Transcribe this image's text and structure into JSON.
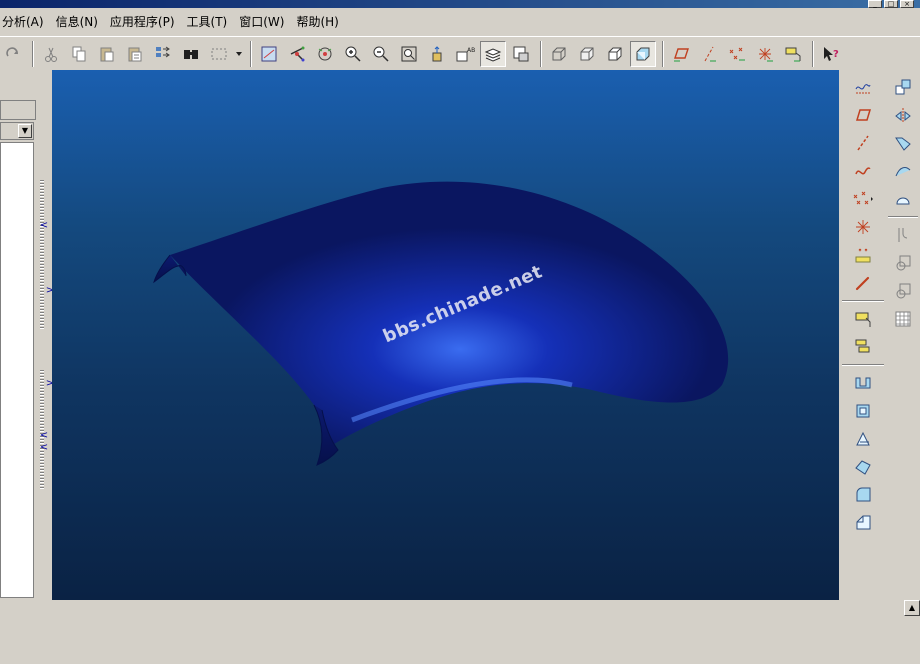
{
  "menubar": {
    "items": [
      "分析(A)",
      "信息(N)",
      "应用程序(P)",
      "工具(T)",
      "窗口(W)",
      "帮助(H)"
    ]
  },
  "window_controls": [
    "_",
    "□",
    "×"
  ],
  "viewport": {
    "watermark": "bbs.chinade.net",
    "background_top": "#1a5fb0",
    "background_bottom": "#0a2244",
    "surface_color": "#0d1f7a"
  },
  "toolbar": {
    "icons": [
      "redo-icon",
      "cut-icon",
      "copy-icon",
      "paste-icon",
      "paste-special-icon",
      "regenerate-icon",
      "search-icon",
      "select-box-icon",
      "dropdown-arrow-icon",
      "orientation-icon",
      "spin-center-icon",
      "named-view-icon",
      "zoom-in-icon",
      "zoom-out-icon",
      "zoom-fit-icon",
      "reorient-icon",
      "saved-views-icon",
      "layers-icon",
      "model-display-icon",
      "wireframe-icon",
      "hidden-line-icon",
      "no-hidden-icon",
      "shading-icon",
      "datum-planes-icon",
      "datum-axes-icon",
      "datum-points-icon",
      "coord-sys-icon",
      "annotation-icon",
      "whats-this-icon"
    ]
  },
  "right_toolbar_a": {
    "icons": [
      "sketch-curve-icon",
      "datum-plane-icon",
      "datum-axis-icon",
      "datum-curve-icon",
      "datum-point-icon",
      "coord-system-icon",
      "analysis-feature-icon",
      "chain-icon",
      "sketch-icon",
      "offset-sketch-icon",
      "extrude-icon",
      "revolve-icon",
      "sweep-icon",
      "blend-icon",
      "round-icon",
      "chamfer-icon"
    ]
  },
  "right_toolbar_b": {
    "icons": [
      "copy-feature-icon",
      "mirror-icon",
      "trim-icon",
      "extend-icon",
      "boundary-blend-icon",
      "merge-icon",
      "intersect-icon",
      "offset-icon",
      "pattern-icon"
    ]
  },
  "left_panel": {
    "combo_arrow": "▼"
  },
  "scrollbar": {
    "up_arrow": "▲"
  }
}
